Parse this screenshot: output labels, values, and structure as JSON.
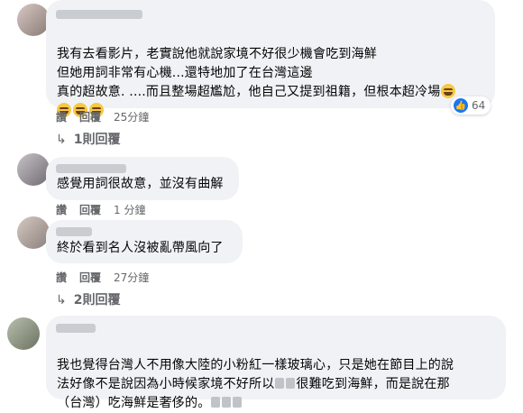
{
  "comments": [
    {
      "lines": [
        "我有去看影片，老實說他就說家境不好很少機會吃到海鮮",
        "但她用詞非常有心機...還特地加了在台灣這邊",
        "真的超故意. ....而且整場超尷尬，他自己又提到祖籍，但根本超冷場"
      ],
      "actions": [
        "讚",
        "回覆"
      ],
      "time": "25分鐘",
      "reaction_count": "64",
      "reply_link": "1則回覆"
    },
    {
      "lines": [
        "感覺用詞很故意，並沒有曲解"
      ],
      "actions": [
        "讚",
        "回覆"
      ],
      "time": "1 分鐘"
    },
    {
      "lines": [
        "終於看到名人沒被亂帶風向了"
      ],
      "actions": [
        "讚",
        "回覆"
      ],
      "time": "27分鐘",
      "reply_link": "2則回覆"
    },
    {
      "lines": [
        "我也覺得台灣人不用像大陸的小粉紅一樣玻璃心，只是她在節目上的說",
        "法好像不是說因為小時候家境不好所以",
        "很難吃到海鮮，而是說在那",
        "（台灣）吃海鮮是奢侈的。"
      ]
    }
  ],
  "colors": {
    "bubble": "#f0f2f5",
    "secondary_text": "#65676b",
    "like_blue": "#1877f2"
  }
}
